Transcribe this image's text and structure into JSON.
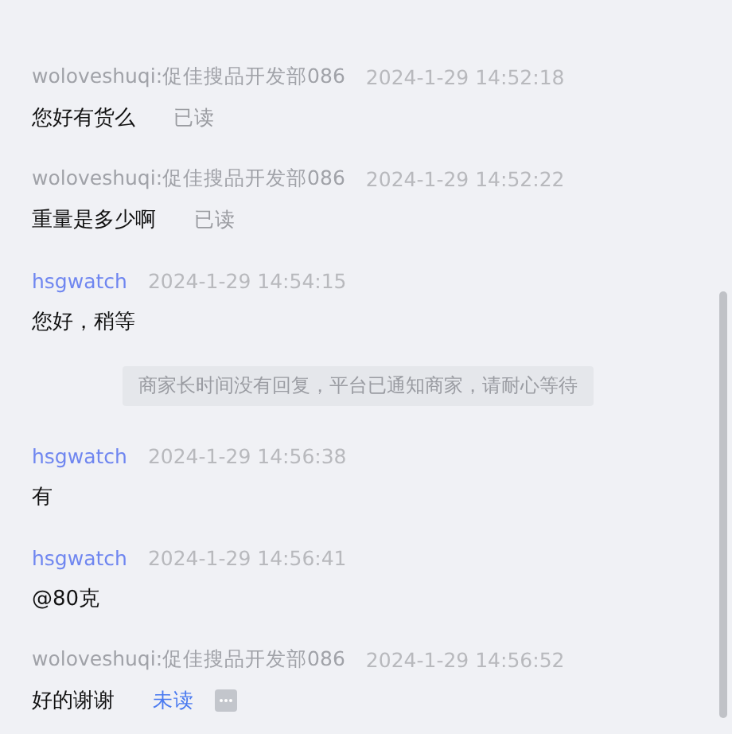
{
  "messages": [
    {
      "kind": "message",
      "seller": false,
      "sender": "woloveshuqi:促佳搜品开发部086",
      "time": "2024-1-29 14:52:18",
      "text": "您好有货么",
      "status": "已读",
      "read": true
    },
    {
      "kind": "message",
      "seller": false,
      "sender": "woloveshuqi:促佳搜品开发部086",
      "time": "2024-1-29 14:52:22",
      "text": "重量是多少啊",
      "status": "已读",
      "read": true
    },
    {
      "kind": "message",
      "seller": true,
      "sender": "hsgwatch",
      "time": "2024-1-29 14:54:15",
      "text": "您好，稍等"
    },
    {
      "kind": "notice",
      "text": "商家长时间没有回复，平台已通知商家，请耐心等待"
    },
    {
      "kind": "message",
      "seller": true,
      "sender": "hsgwatch",
      "time": "2024-1-29 14:56:38",
      "text": "有"
    },
    {
      "kind": "message",
      "seller": true,
      "sender": "hsgwatch",
      "time": "2024-1-29 14:56:41",
      "text": "@80克"
    },
    {
      "kind": "message",
      "seller": false,
      "sender": "woloveshuqi:促佳搜品开发部086",
      "time": "2024-1-29 14:56:52",
      "text": "好的谢谢",
      "status": "未读",
      "read": false,
      "more": true
    }
  ]
}
